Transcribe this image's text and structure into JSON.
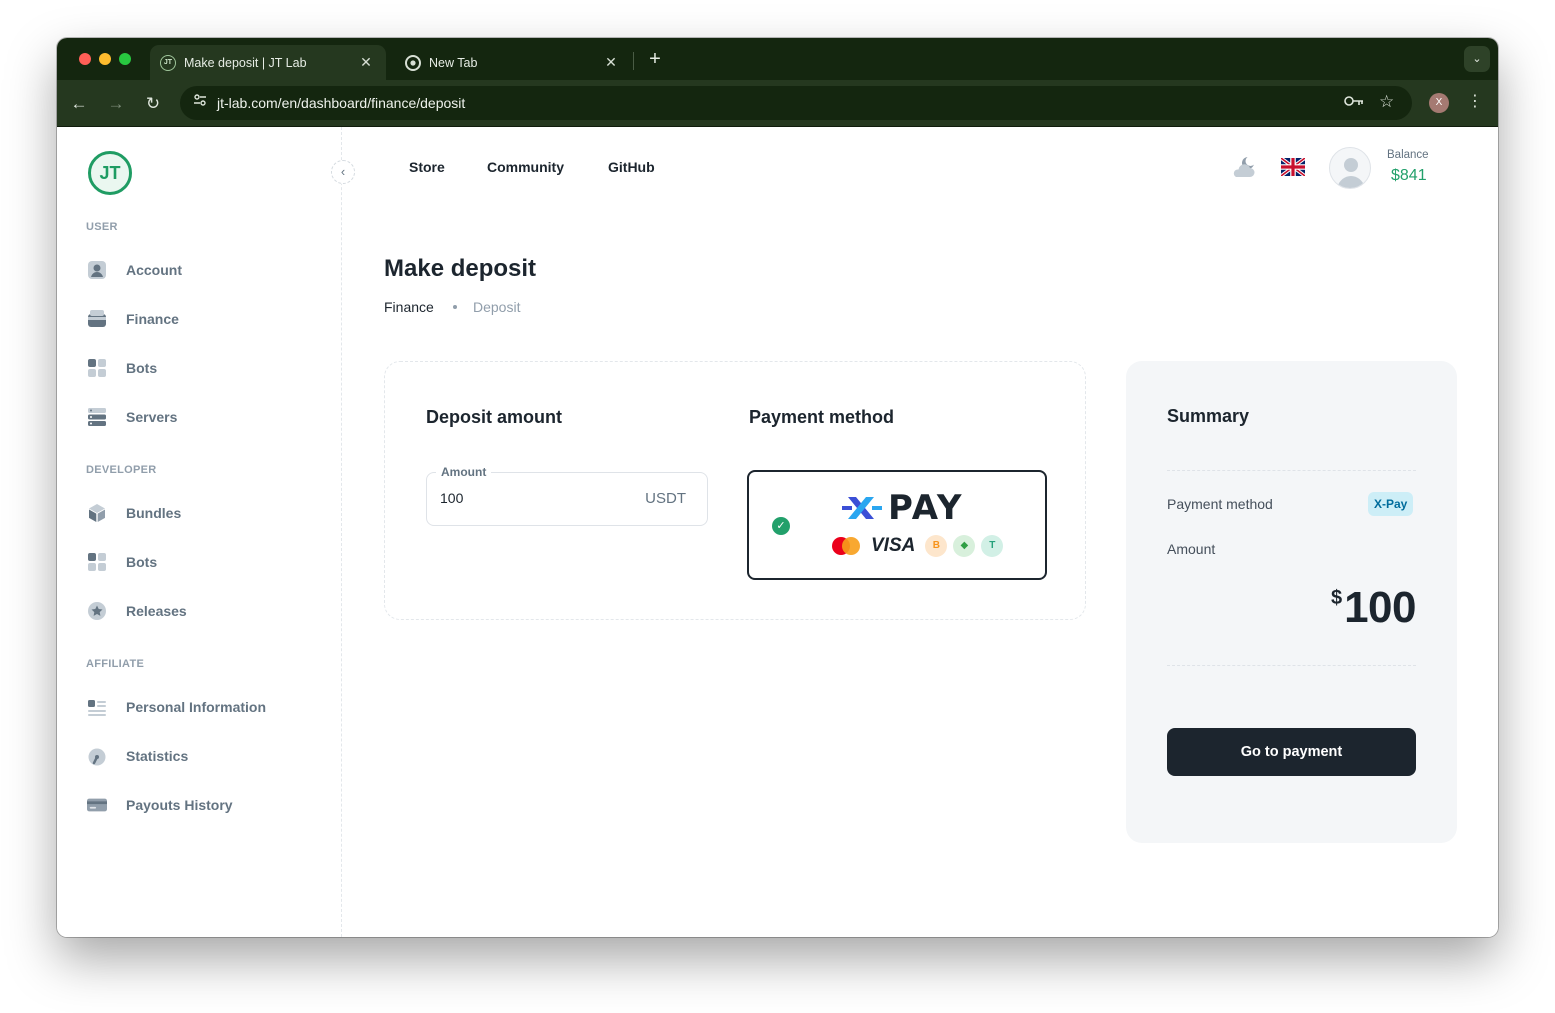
{
  "browser": {
    "tabs": [
      {
        "title": "Make deposit | JT Lab",
        "favicon": "JT"
      },
      {
        "title": "New Tab"
      }
    ],
    "url": "jt-lab.com/en/dashboard/finance/deposit",
    "profile_initial": "X"
  },
  "sidebar": {
    "sections": [
      {
        "title": "USER",
        "items": [
          "Account",
          "Finance",
          "Bots",
          "Servers"
        ]
      },
      {
        "title": "DEVELOPER",
        "items": [
          "Bundles",
          "Bots",
          "Releases"
        ]
      },
      {
        "title": "AFFILIATE",
        "items": [
          "Personal Information",
          "Statistics",
          "Payouts History"
        ]
      }
    ],
    "logo_text": "JT"
  },
  "header": {
    "nav": [
      "Store",
      "Community",
      "GitHub"
    ],
    "balance_label": "Balance",
    "balance_value": "$841"
  },
  "page": {
    "title": "Make deposit",
    "breadcrumb": [
      "Finance",
      "Deposit"
    ]
  },
  "deposit": {
    "heading": "Deposit amount",
    "field_label": "Amount",
    "field_value": "100",
    "field_unit": "USDT"
  },
  "payment": {
    "heading": "Payment method",
    "option_name": "PAY",
    "option_brand": "VISA",
    "coins": [
      "B",
      "◆",
      "T"
    ]
  },
  "summary": {
    "heading": "Summary",
    "method_label": "Payment method",
    "method_value": "X-Pay",
    "amount_label": "Amount",
    "amount_currency": "$",
    "amount_value": "100",
    "button": "Go to payment"
  },
  "colors": {
    "accent_green": "#22a06b",
    "dark": "#1c252e",
    "chrome": "#14260f"
  }
}
